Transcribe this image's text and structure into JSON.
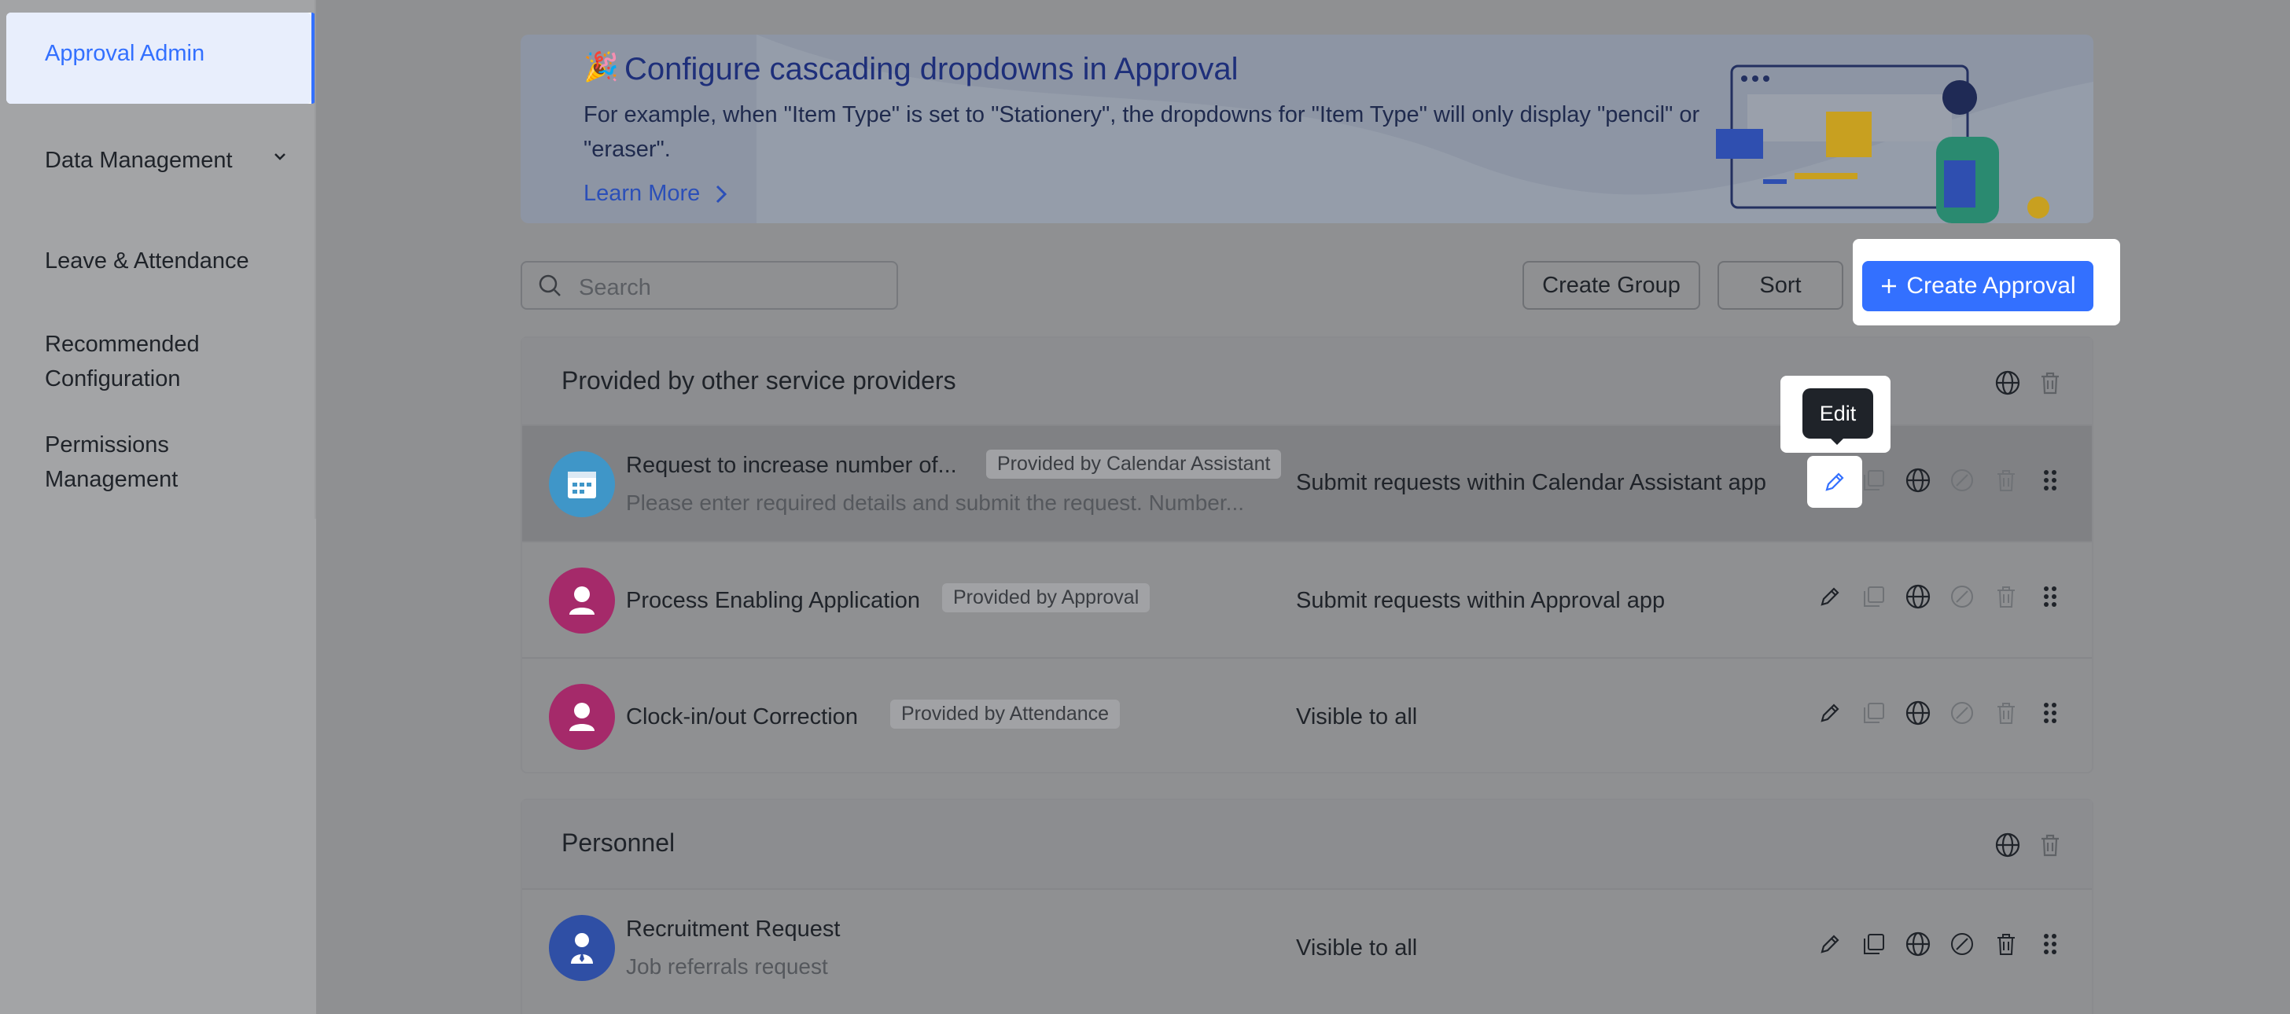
{
  "sidebar": {
    "items": [
      {
        "label": "Approval Admin",
        "active": true
      },
      {
        "label": "Data Management",
        "has_chevron": true
      },
      {
        "label": "Leave & Attendance"
      },
      {
        "label": "Recommended",
        "label2": "Configuration"
      },
      {
        "label": "Permissions",
        "label2": "Management"
      }
    ]
  },
  "banner": {
    "emoji": "🎉",
    "title": "Configure cascading dropdowns in Approval",
    "desc": "For example, when \"Item Type\" is set to \"Stationery\", the dropdowns for \"Item Type\" will only display \"pencil\" or \"eraser\".",
    "link": "Learn More"
  },
  "toolbar": {
    "search_placeholder": "Search",
    "create_group": "Create Group",
    "sort": "Sort",
    "create_approval": "Create Approval"
  },
  "tooltip": {
    "text": "Edit"
  },
  "groups": [
    {
      "title": "Provided by other service providers",
      "rows": [
        {
          "name": "Request to increase number of...",
          "tag": "Provided by Calendar Assistant",
          "desc": "Please enter required details and submit the request. Number...",
          "scope": "Submit requests within Calendar Assistant app",
          "avatar_color": "#3f96c8"
        },
        {
          "name": "Process Enabling Application",
          "tag": "Provided by Approval",
          "scope": "Submit requests within Approval app",
          "avatar_color": "#a52a6a"
        },
        {
          "name": "Clock-in/out Correction",
          "tag": "Provided by Attendance",
          "scope": "Visible to all",
          "avatar_color": "#a52a6a"
        }
      ]
    },
    {
      "title": "Personnel",
      "rows": [
        {
          "name": "Recruitment Request",
          "desc": "Job referrals request",
          "scope": "Visible to all",
          "avatar_color": "#2f4fa5"
        }
      ]
    }
  ],
  "colors": {
    "accent": "#3370ff",
    "overlay": "#8f9092"
  },
  "icons": [
    "edit-icon",
    "copy-icon",
    "globe-icon",
    "disable-icon",
    "trash-icon",
    "drag-handle-icon",
    "search-icon",
    "chevron-down-icon",
    "chevron-right-icon",
    "plus-icon"
  ]
}
